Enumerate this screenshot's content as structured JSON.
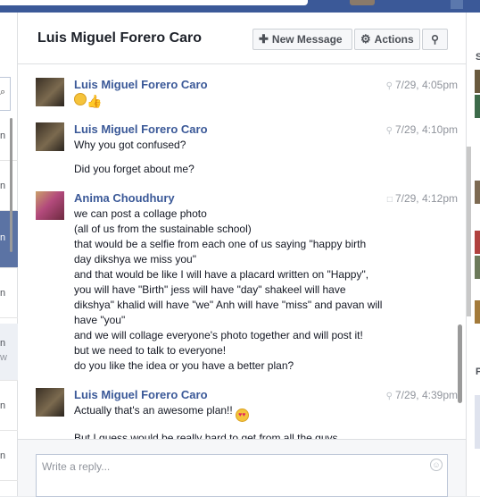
{
  "header": {
    "title": "Luis Miguel Forero Caro",
    "new_message_label": "New Message",
    "actions_label": "Actions"
  },
  "left_rail": {
    "rows": [
      "n",
      "n",
      "n",
      "n",
      "n",
      "w",
      "n",
      "n"
    ]
  },
  "right_rail": {
    "label_top": "S",
    "label_bottom": "P"
  },
  "messages": [
    {
      "name": "Luis Miguel Forero Caro",
      "time": "7/29, 4:05pm",
      "lines": []
    },
    {
      "name": "Luis Miguel Forero Caro",
      "time": "7/29, 4:10pm",
      "lines": [
        "Why you got confused?",
        "Did you forget about me?"
      ]
    },
    {
      "name": "Anima Choudhury",
      "time": "7/29, 4:12pm",
      "lines": [
        "we can post a collage photo",
        "(all of us from the sustainable school)",
        "that would be a selfie from each one of us saying \"happy birth",
        "day dikshya we miss you\"",
        "and that would be like I will have a placard written on \"Happy\",",
        "you will have \"Birth\" jess will have \"day\" shakeel will have",
        "dikshya\" khalid will have \"we\" Anh will have \"miss\" and pavan will",
        "have \"you\"",
        "and we will collage everyone's photo together and will post it!",
        "but we need to talk to everyone!",
        "do you like the idea or you have a better plan?"
      ]
    },
    {
      "name": "Luis Miguel Forero Caro",
      "time": "7/29, 4:39pm",
      "lines": [
        "Actually that's an awesome plan!!",
        "But I guess would be really hard to get from all the guys..."
      ]
    }
  ],
  "composer": {
    "placeholder": "Write a reply..."
  },
  "icons": {
    "new_message": "plus-icon",
    "actions": "gear-icon",
    "search": "search-icon",
    "time_marker": "location-pin-icon",
    "time_marker_alt": "chat-bubble-icon",
    "emoji": "smiley-icon"
  },
  "colors": {
    "topbar": "#3b5998",
    "name_link": "#3b5998",
    "selected_row": "#5b73a4"
  }
}
